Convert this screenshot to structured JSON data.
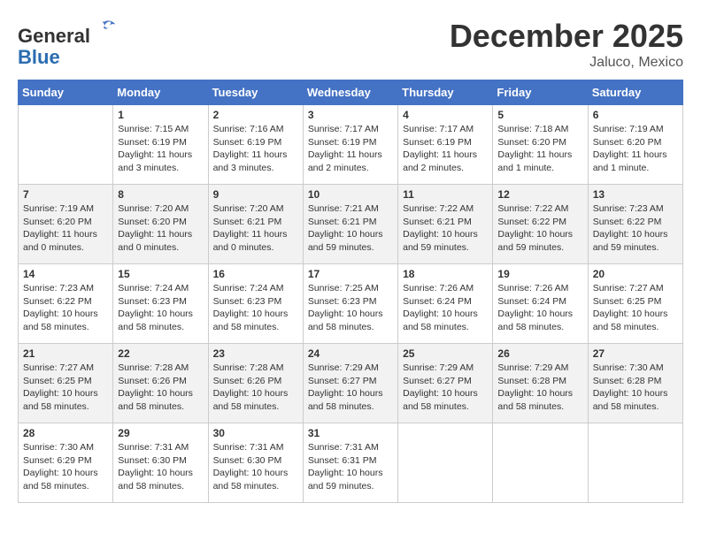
{
  "header": {
    "logo_line1": "General",
    "logo_line2": "Blue",
    "month_title": "December 2025",
    "location": "Jaluco, Mexico"
  },
  "weekdays": [
    "Sunday",
    "Monday",
    "Tuesday",
    "Wednesday",
    "Thursday",
    "Friday",
    "Saturday"
  ],
  "weeks": [
    [
      {
        "day": "",
        "info": ""
      },
      {
        "day": "1",
        "info": "Sunrise: 7:15 AM\nSunset: 6:19 PM\nDaylight: 11 hours\nand 3 minutes."
      },
      {
        "day": "2",
        "info": "Sunrise: 7:16 AM\nSunset: 6:19 PM\nDaylight: 11 hours\nand 3 minutes."
      },
      {
        "day": "3",
        "info": "Sunrise: 7:17 AM\nSunset: 6:19 PM\nDaylight: 11 hours\nand 2 minutes."
      },
      {
        "day": "4",
        "info": "Sunrise: 7:17 AM\nSunset: 6:19 PM\nDaylight: 11 hours\nand 2 minutes."
      },
      {
        "day": "5",
        "info": "Sunrise: 7:18 AM\nSunset: 6:20 PM\nDaylight: 11 hours\nand 1 minute."
      },
      {
        "day": "6",
        "info": "Sunrise: 7:19 AM\nSunset: 6:20 PM\nDaylight: 11 hours\nand 1 minute."
      }
    ],
    [
      {
        "day": "7",
        "info": "Sunrise: 7:19 AM\nSunset: 6:20 PM\nDaylight: 11 hours\nand 0 minutes."
      },
      {
        "day": "8",
        "info": "Sunrise: 7:20 AM\nSunset: 6:20 PM\nDaylight: 11 hours\nand 0 minutes."
      },
      {
        "day": "9",
        "info": "Sunrise: 7:20 AM\nSunset: 6:21 PM\nDaylight: 11 hours\nand 0 minutes."
      },
      {
        "day": "10",
        "info": "Sunrise: 7:21 AM\nSunset: 6:21 PM\nDaylight: 10 hours\nand 59 minutes."
      },
      {
        "day": "11",
        "info": "Sunrise: 7:22 AM\nSunset: 6:21 PM\nDaylight: 10 hours\nand 59 minutes."
      },
      {
        "day": "12",
        "info": "Sunrise: 7:22 AM\nSunset: 6:22 PM\nDaylight: 10 hours\nand 59 minutes."
      },
      {
        "day": "13",
        "info": "Sunrise: 7:23 AM\nSunset: 6:22 PM\nDaylight: 10 hours\nand 59 minutes."
      }
    ],
    [
      {
        "day": "14",
        "info": "Sunrise: 7:23 AM\nSunset: 6:22 PM\nDaylight: 10 hours\nand 58 minutes."
      },
      {
        "day": "15",
        "info": "Sunrise: 7:24 AM\nSunset: 6:23 PM\nDaylight: 10 hours\nand 58 minutes."
      },
      {
        "day": "16",
        "info": "Sunrise: 7:24 AM\nSunset: 6:23 PM\nDaylight: 10 hours\nand 58 minutes."
      },
      {
        "day": "17",
        "info": "Sunrise: 7:25 AM\nSunset: 6:23 PM\nDaylight: 10 hours\nand 58 minutes."
      },
      {
        "day": "18",
        "info": "Sunrise: 7:26 AM\nSunset: 6:24 PM\nDaylight: 10 hours\nand 58 minutes."
      },
      {
        "day": "19",
        "info": "Sunrise: 7:26 AM\nSunset: 6:24 PM\nDaylight: 10 hours\nand 58 minutes."
      },
      {
        "day": "20",
        "info": "Sunrise: 7:27 AM\nSunset: 6:25 PM\nDaylight: 10 hours\nand 58 minutes."
      }
    ],
    [
      {
        "day": "21",
        "info": "Sunrise: 7:27 AM\nSunset: 6:25 PM\nDaylight: 10 hours\nand 58 minutes."
      },
      {
        "day": "22",
        "info": "Sunrise: 7:28 AM\nSunset: 6:26 PM\nDaylight: 10 hours\nand 58 minutes."
      },
      {
        "day": "23",
        "info": "Sunrise: 7:28 AM\nSunset: 6:26 PM\nDaylight: 10 hours\nand 58 minutes."
      },
      {
        "day": "24",
        "info": "Sunrise: 7:29 AM\nSunset: 6:27 PM\nDaylight: 10 hours\nand 58 minutes."
      },
      {
        "day": "25",
        "info": "Sunrise: 7:29 AM\nSunset: 6:27 PM\nDaylight: 10 hours\nand 58 minutes."
      },
      {
        "day": "26",
        "info": "Sunrise: 7:29 AM\nSunset: 6:28 PM\nDaylight: 10 hours\nand 58 minutes."
      },
      {
        "day": "27",
        "info": "Sunrise: 7:30 AM\nSunset: 6:28 PM\nDaylight: 10 hours\nand 58 minutes."
      }
    ],
    [
      {
        "day": "28",
        "info": "Sunrise: 7:30 AM\nSunset: 6:29 PM\nDaylight: 10 hours\nand 58 minutes."
      },
      {
        "day": "29",
        "info": "Sunrise: 7:31 AM\nSunset: 6:30 PM\nDaylight: 10 hours\nand 58 minutes."
      },
      {
        "day": "30",
        "info": "Sunrise: 7:31 AM\nSunset: 6:30 PM\nDaylight: 10 hours\nand 58 minutes."
      },
      {
        "day": "31",
        "info": "Sunrise: 7:31 AM\nSunset: 6:31 PM\nDaylight: 10 hours\nand 59 minutes."
      },
      {
        "day": "",
        "info": ""
      },
      {
        "day": "",
        "info": ""
      },
      {
        "day": "",
        "info": ""
      }
    ]
  ]
}
